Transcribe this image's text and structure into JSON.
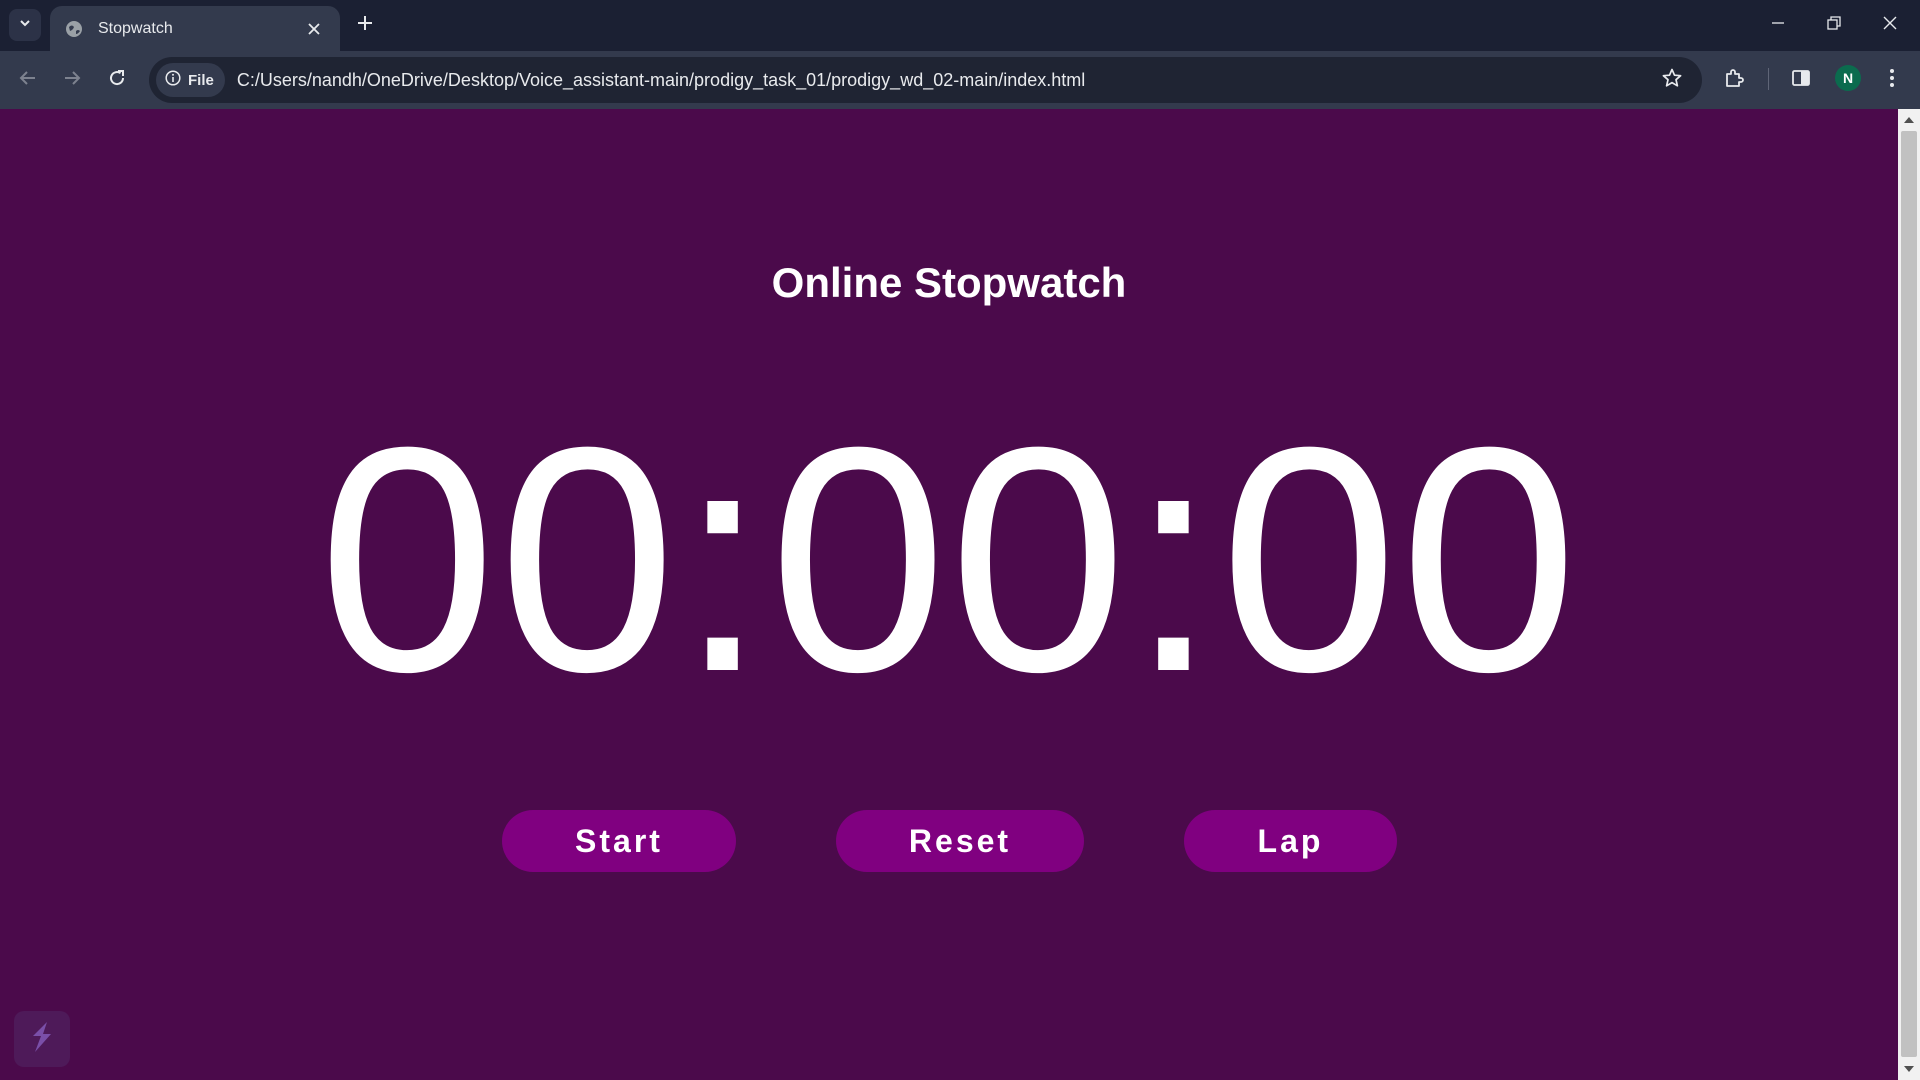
{
  "browser": {
    "tab": {
      "title": "Stopwatch"
    },
    "address_bar": {
      "scheme_chip": "File",
      "url": "C:/Users/nandh/OneDrive/Desktop/Voice_assistant-main/prodigy_task_01/prodigy_wd_02-main/index.html"
    },
    "profile_initial": "N"
  },
  "page": {
    "title": "Online Stopwatch",
    "timer_display": "00:00:00",
    "buttons": {
      "start": "Start",
      "reset": "Reset",
      "lap": "Lap"
    }
  },
  "colors": {
    "page_background": "#4b0a4b",
    "button_background": "#800080",
    "text": "#ffffff"
  }
}
